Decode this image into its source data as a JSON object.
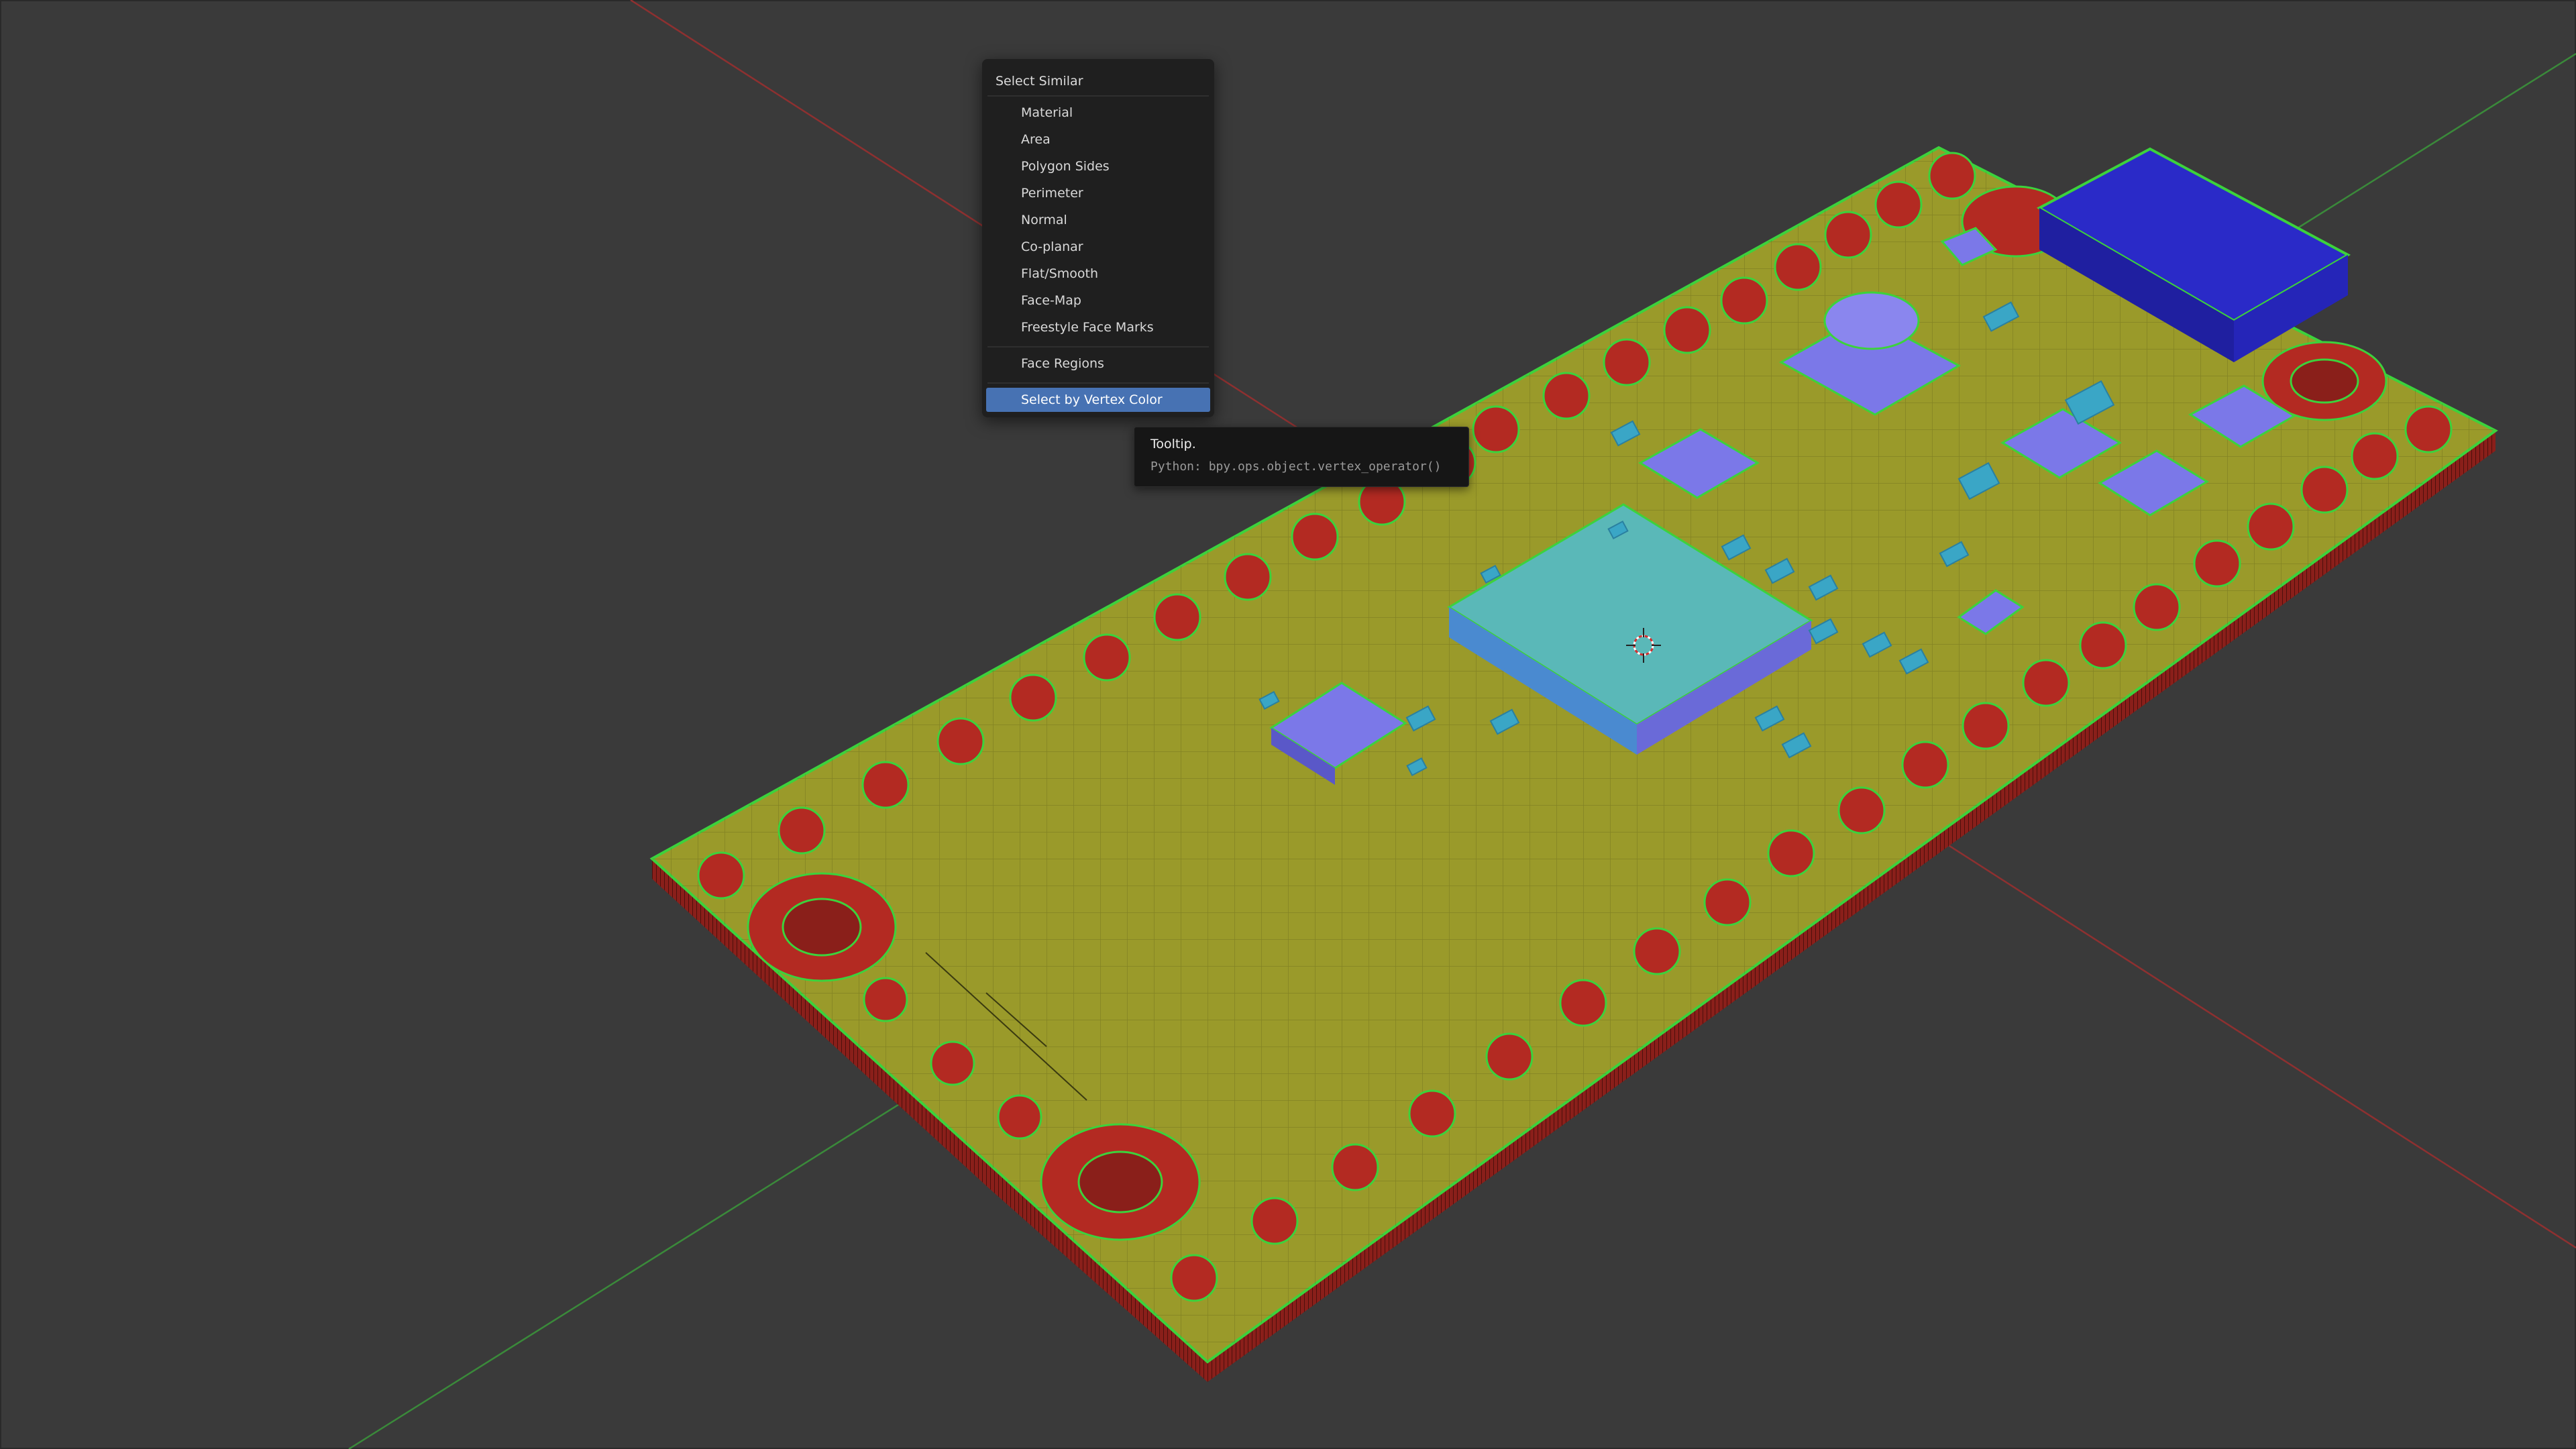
{
  "menu": {
    "title": "Select Similar",
    "items": [
      {
        "label": "Material"
      },
      {
        "label": "Area"
      },
      {
        "label": "Polygon Sides"
      },
      {
        "label": "Perimeter"
      },
      {
        "label": "Normal"
      },
      {
        "label": "Co-planar"
      },
      {
        "label": "Flat/Smooth"
      },
      {
        "label": "Face-Map"
      },
      {
        "label": "Freestyle Face Marks"
      },
      {
        "label": "Face Regions"
      },
      {
        "label": "Select by Vertex Color"
      }
    ],
    "active_item": "Select by Vertex Color"
  },
  "tooltip": {
    "title": "Tooltip.",
    "python": "Python: bpy.ops.object.vertex_operator()"
  },
  "colors": {
    "viewport_bg": "#3a3a3a",
    "board_face": "#9a9a2a",
    "pad_red": "#b32a22",
    "edge_green": "#3cd23c",
    "component_purple": "#7b78e8",
    "component_blue": "#2a2ac8",
    "chip_cyan": "#5ab8b8",
    "menu_bg": "#1f1f1f",
    "menu_highlight": "#4772b3",
    "axis_red": "#a03030",
    "axis_green": "#3a9a3a"
  },
  "icons": {
    "cursor": "3d-cursor-icon"
  }
}
